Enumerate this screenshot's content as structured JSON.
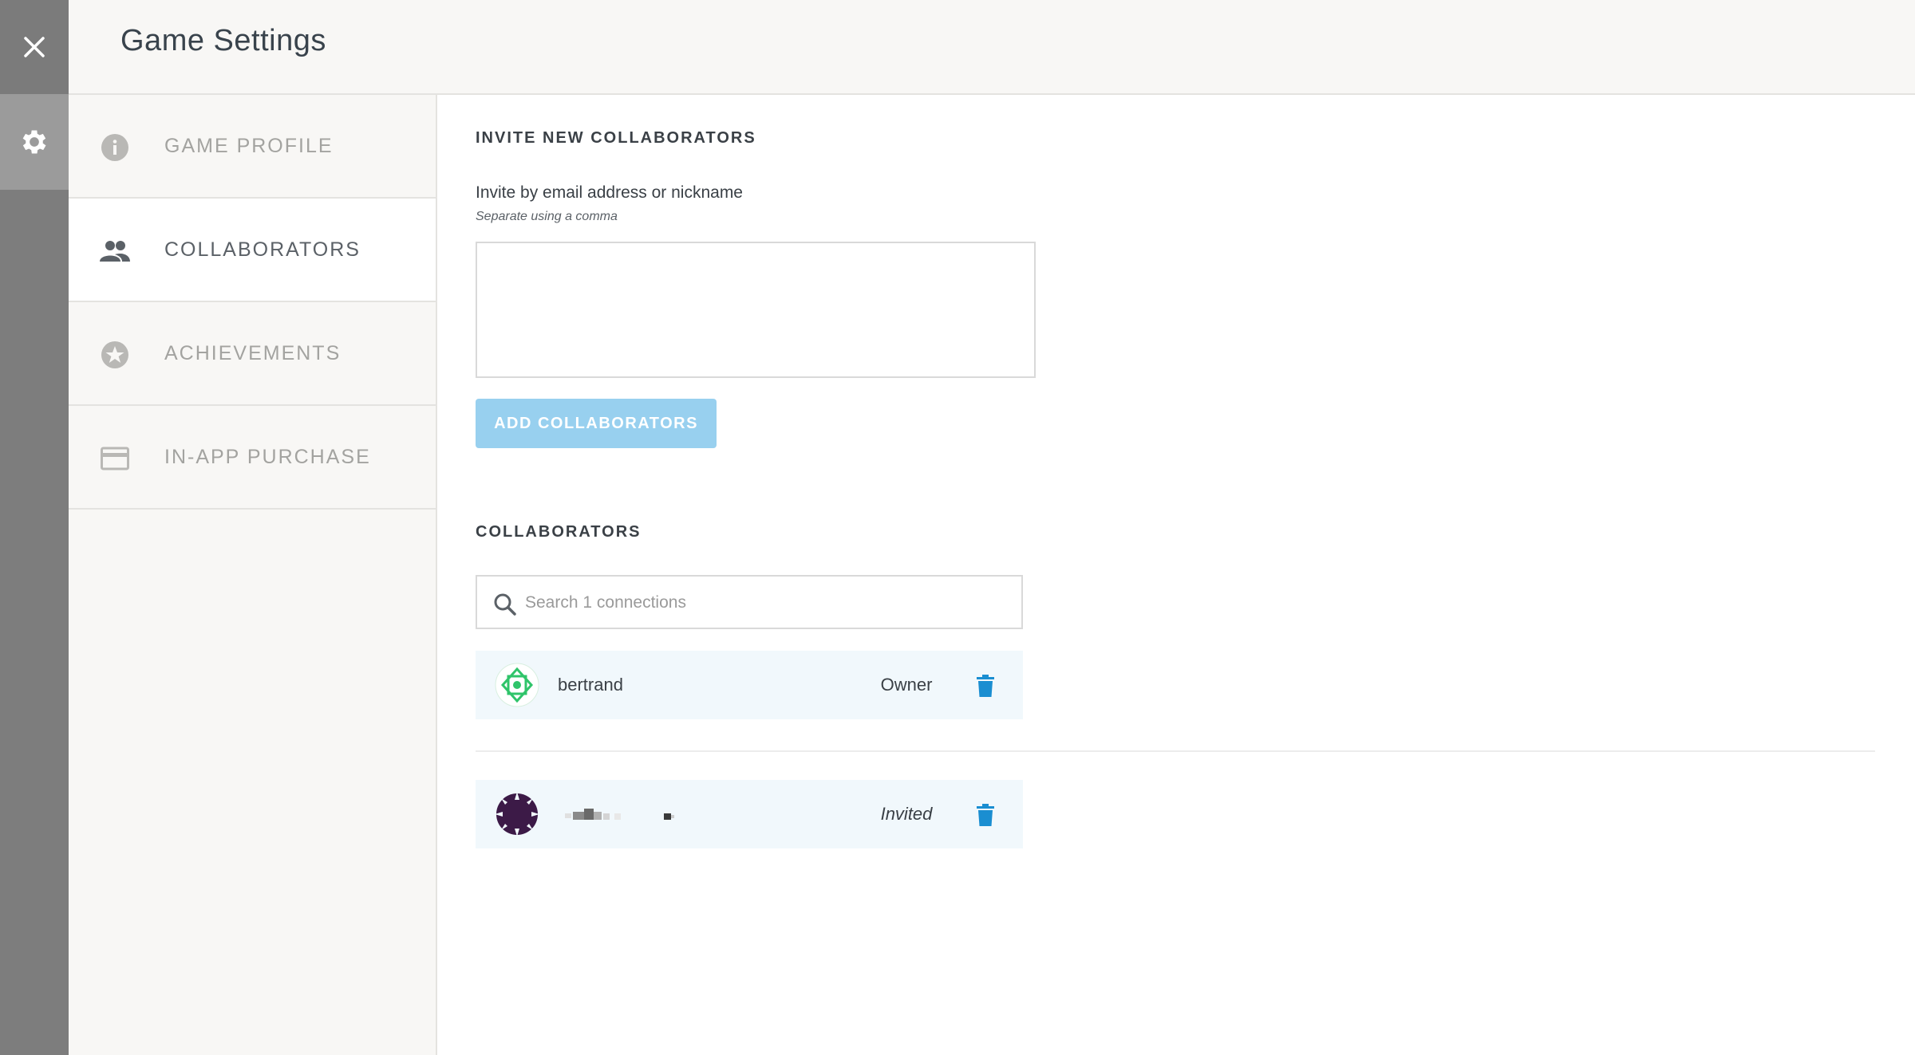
{
  "header": {
    "title": "Game Settings"
  },
  "rail": {
    "close_icon": "close-icon",
    "settings_icon": "gear-icon"
  },
  "nav": {
    "items": [
      {
        "label": "GAME PROFILE",
        "icon": "info-icon",
        "active": false
      },
      {
        "label": "COLLABORATORS",
        "icon": "people-icon",
        "active": true
      },
      {
        "label": "ACHIEVEMENTS",
        "icon": "star-badge-icon",
        "active": false
      },
      {
        "label": "IN-APP PURCHASE",
        "icon": "credit-card-icon",
        "active": false
      }
    ]
  },
  "invite": {
    "title": "INVITE NEW COLLABORATORS",
    "label": "Invite by email address or nickname",
    "hint": "Separate using a comma",
    "value": "",
    "button_label": "ADD COLLABORATORS"
  },
  "collaborators": {
    "title": "COLLABORATORS",
    "search_placeholder": "Search 1 connections",
    "rows": [
      {
        "name": "bertrand",
        "role": "Owner"
      },
      {
        "name": "",
        "role": "Invited"
      }
    ]
  },
  "colors": {
    "accent_button": "#98d0ef",
    "trash": "#1a8ed1",
    "row_bg": "#f1f8fc",
    "rail": "#7d7d7d"
  }
}
